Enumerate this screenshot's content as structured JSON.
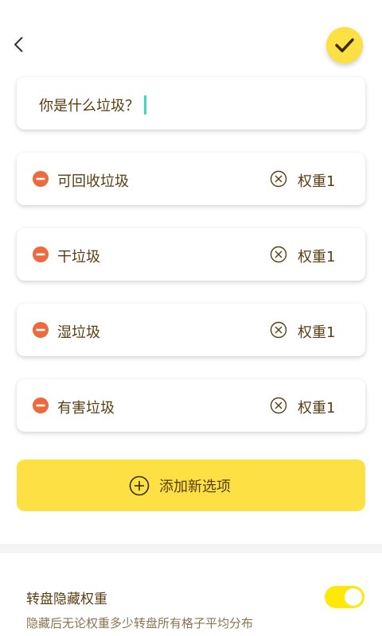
{
  "header": {
    "back_icon": "chevron-left-icon",
    "confirm_icon": "check-icon"
  },
  "title_input": {
    "value": "你是什么垃圾？"
  },
  "options": [
    {
      "label": "可回收垃圾",
      "weight": "权重1"
    },
    {
      "label": "干垃圾",
      "weight": "权重1"
    },
    {
      "label": "湿垃圾",
      "weight": "权重1"
    },
    {
      "label": "有害垃圾",
      "weight": "权重1"
    }
  ],
  "add_button": {
    "label": "添加新选项"
  },
  "settings": {
    "hide_weight_title": "转盘隐藏权重",
    "hide_weight_desc": "隐藏后无论权重多少转盘所有格子平均分布",
    "hide_weight_on": true
  },
  "colors": {
    "accent": "#fde043",
    "remove": "#ee6a3e",
    "text": "#5a3d10",
    "caret": "#3fd8c0"
  }
}
